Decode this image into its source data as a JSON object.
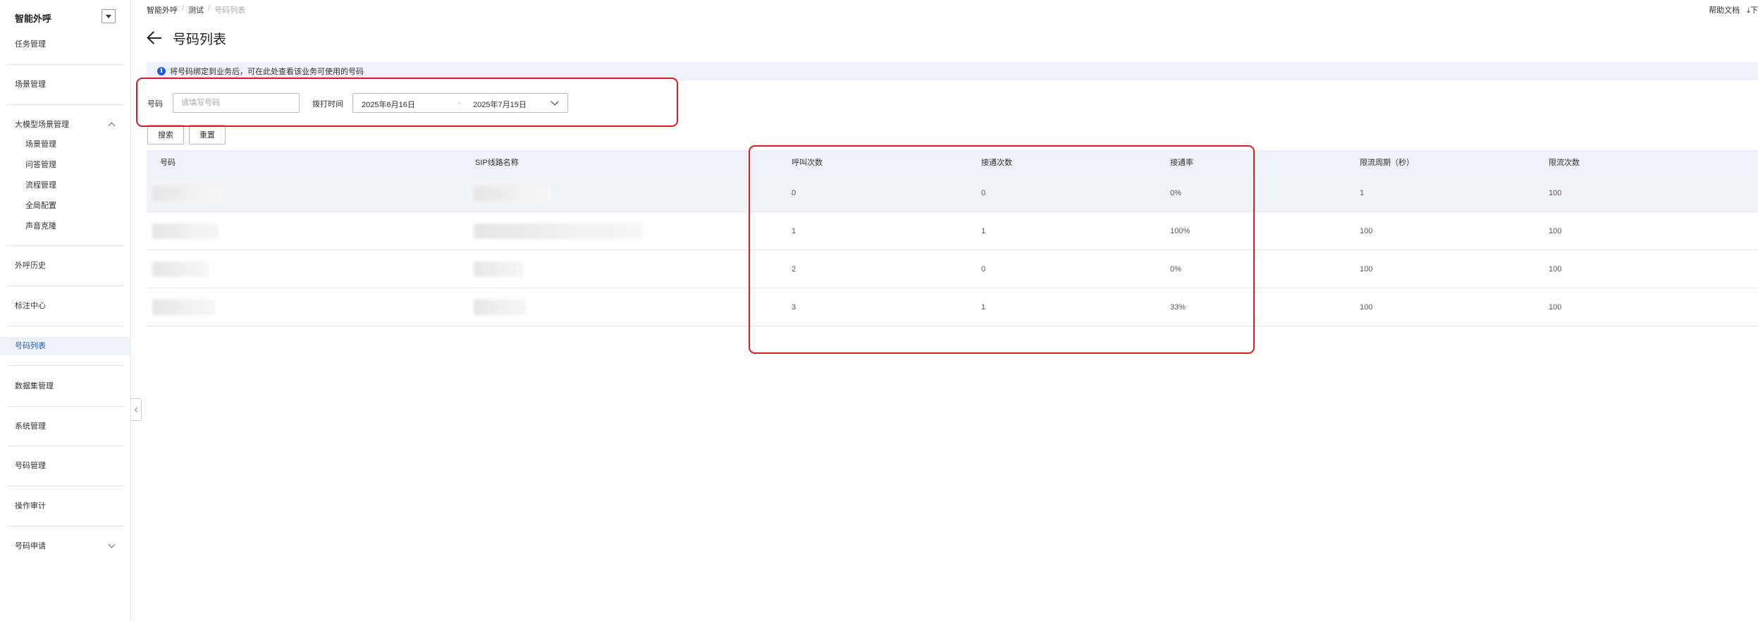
{
  "sidebar": {
    "title": "智能外呼",
    "items": [
      {
        "label": "任务管理"
      },
      {
        "label": "场景管理"
      },
      {
        "label": "大模型场景管理"
      },
      {
        "label": "外呼历史"
      },
      {
        "label": "标注中心"
      },
      {
        "label": "号码列表"
      },
      {
        "label": "数据集管理"
      },
      {
        "label": "系统管理"
      },
      {
        "label": "号码管理"
      },
      {
        "label": "操作审计"
      },
      {
        "label": "号码申请"
      }
    ],
    "subitems": [
      {
        "label": "场景管理"
      },
      {
        "label": "问答管理"
      },
      {
        "label": "流程管理"
      },
      {
        "label": "全局配置"
      },
      {
        "label": "声音克隆"
      }
    ]
  },
  "breadcrumb": {
    "items": [
      "智能外呼",
      "测试",
      "号码列表"
    ]
  },
  "top_right": {
    "help": "帮助文档",
    "download": "下"
  },
  "page": {
    "title": "号码列表"
  },
  "banner": {
    "text": "将号码绑定到业务后，可在此处查看该业务可使用的号码"
  },
  "filters": {
    "number_label": "号码",
    "number_placeholder": "请填写号码",
    "time_label": "拨打时间",
    "date_start": "2025年6月16日",
    "date_sep": "-",
    "date_end": "2025年7月15日"
  },
  "buttons": {
    "search": "搜索",
    "reset": "重置"
  },
  "table": {
    "headers": [
      "号码",
      "SIP线路名称",
      "呼叫次数",
      "接通次数",
      "接通率",
      "限流周期（秒）",
      "限流次数"
    ],
    "rows": [
      {
        "calls": "0",
        "connected": "0",
        "rate": "0%",
        "period": "1",
        "limit": "100"
      },
      {
        "calls": "1",
        "connected": "1",
        "rate": "100%",
        "period": "100",
        "limit": "100"
      },
      {
        "calls": "2",
        "connected": "0",
        "rate": "0%",
        "period": "100",
        "limit": "100"
      },
      {
        "calls": "3",
        "connected": "1",
        "rate": "33%",
        "period": "100",
        "limit": "100"
      }
    ]
  },
  "colors": {
    "accent": "#1f5fd6",
    "annotation": "#d81e1e",
    "banner_bg": "#eef1f6"
  }
}
